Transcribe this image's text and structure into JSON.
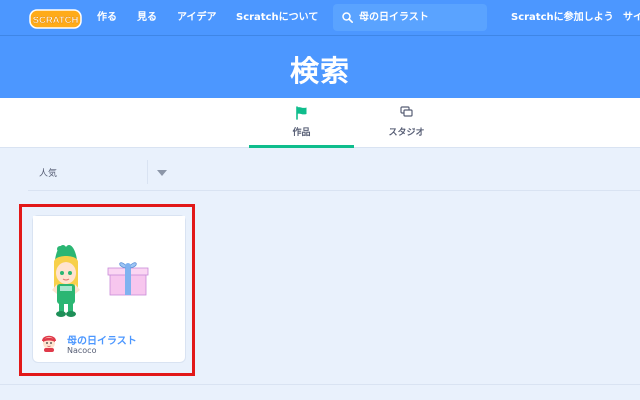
{
  "nav": {
    "logo_text": "SCRATCH",
    "items": [
      "作る",
      "見る",
      "アイデア",
      "Scratchについて"
    ],
    "search_value": "母の日イラスト",
    "join": "Scratchに参加しよう",
    "signin_partial": "サイ"
  },
  "banner": {
    "title": "検索"
  },
  "tabs": [
    {
      "label": "作品",
      "active": true,
      "icon": "flag-icon"
    },
    {
      "label": "スタジオ",
      "active": false,
      "icon": "studio-icon"
    }
  ],
  "filter": {
    "label": "人気"
  },
  "projects": [
    {
      "title": "母の日イラスト",
      "author": "Nacoco"
    }
  ],
  "colors": {
    "brand_blue": "#4c97ff",
    "accent_green": "#0fbd8c",
    "highlight_red": "#e21818"
  }
}
